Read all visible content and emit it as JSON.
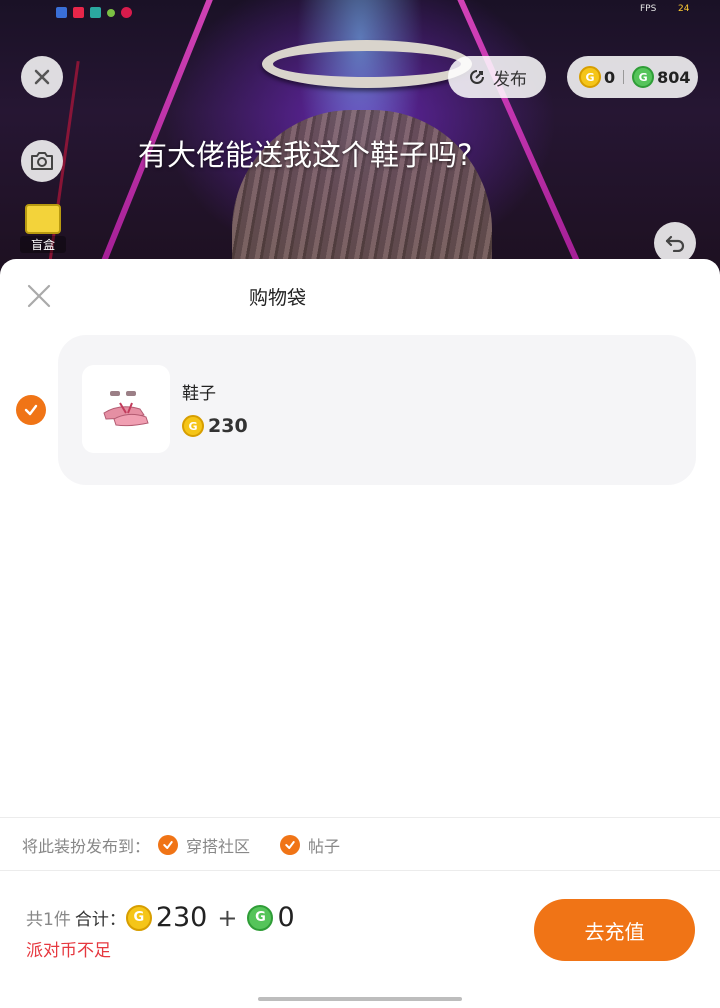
{
  "status_bar": {
    "fps_label": "FPS",
    "fps_value": "24"
  },
  "header": {
    "publish_label": "发布",
    "gold_coins": "0",
    "green_coins": "804",
    "caption": "有大佬能送我这个鞋子吗?",
    "blind_box_label": "盲盒"
  },
  "sheet": {
    "title": "购物袋",
    "items": [
      {
        "name": "鞋子",
        "price": "230",
        "selected": true
      }
    ]
  },
  "publish_to": {
    "label": "将此装扮发布到：",
    "options": [
      {
        "label": "穿搭社区",
        "checked": true
      },
      {
        "label": "帖子",
        "checked": true
      }
    ]
  },
  "footer": {
    "count_label": "共1件",
    "total_label": "合计：",
    "gold_amount": "230",
    "plus": "+",
    "green_amount": "0",
    "warning": "派对币不足",
    "recharge_label": "去充值"
  },
  "colors": {
    "accent": "#f07416",
    "warning": "#e6383f",
    "gold_coin": "#f5c518",
    "green_coin": "#55c45a"
  }
}
